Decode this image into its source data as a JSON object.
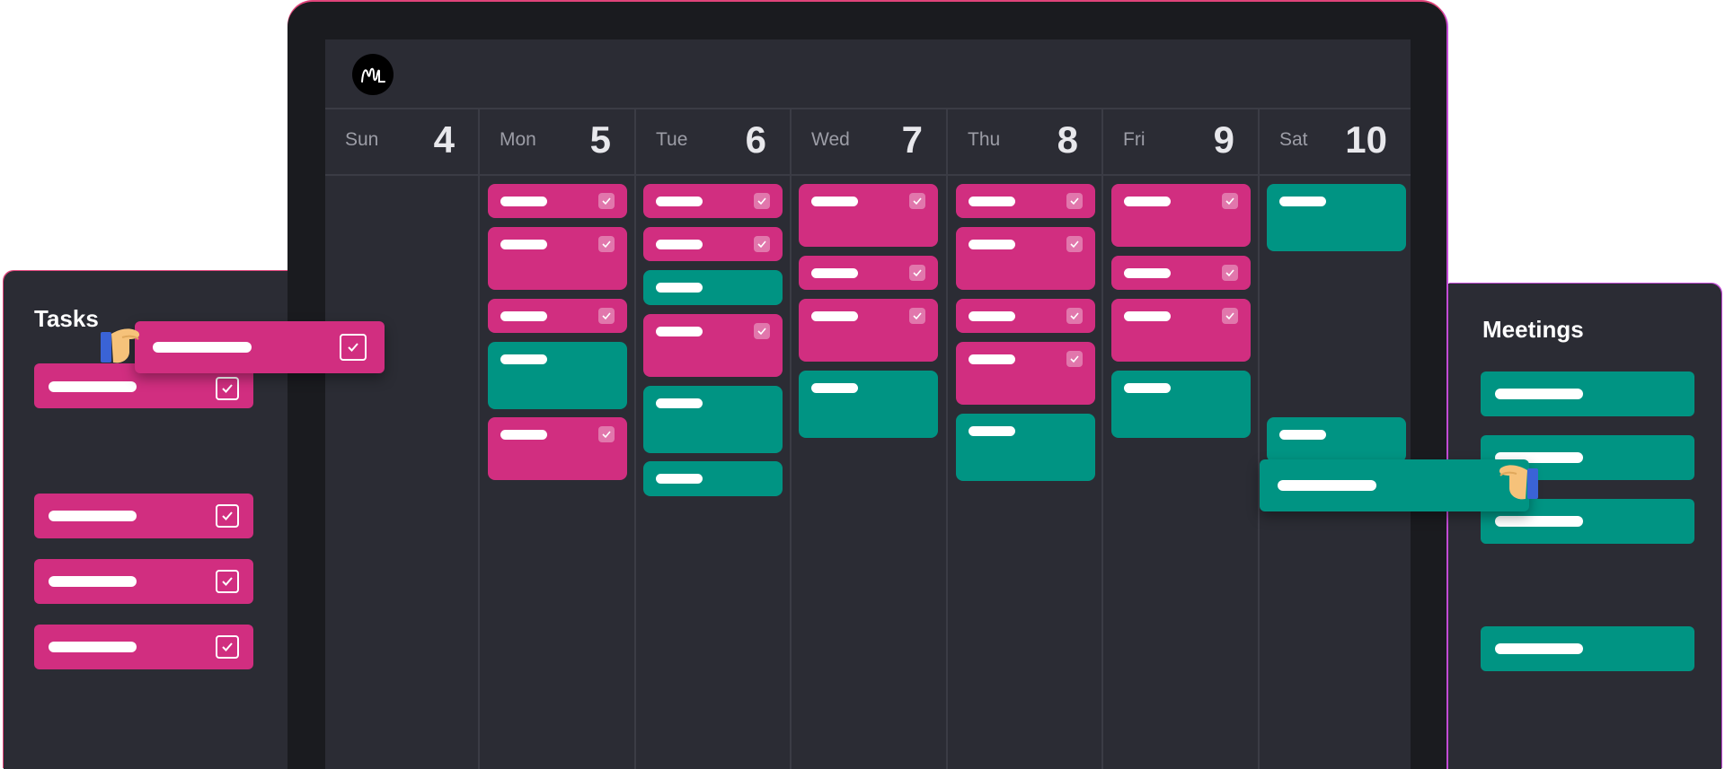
{
  "colors": {
    "task": "#d12e80",
    "meeting": "#009483",
    "screen": "#2b2c34",
    "frame": "#1a1b1f"
  },
  "logo": {
    "icon": "m-logo-icon"
  },
  "days": [
    {
      "name": "Sun",
      "num": "4"
    },
    {
      "name": "Mon",
      "num": "5"
    },
    {
      "name": "Tue",
      "num": "6"
    },
    {
      "name": "Wed",
      "num": "7"
    },
    {
      "name": "Thu",
      "num": "8"
    },
    {
      "name": "Fri",
      "num": "9"
    },
    {
      "name": "Sat",
      "num": "10"
    }
  ],
  "tasks_panel": {
    "title": "Tasks"
  },
  "meetings_panel": {
    "title": "Meetings"
  }
}
